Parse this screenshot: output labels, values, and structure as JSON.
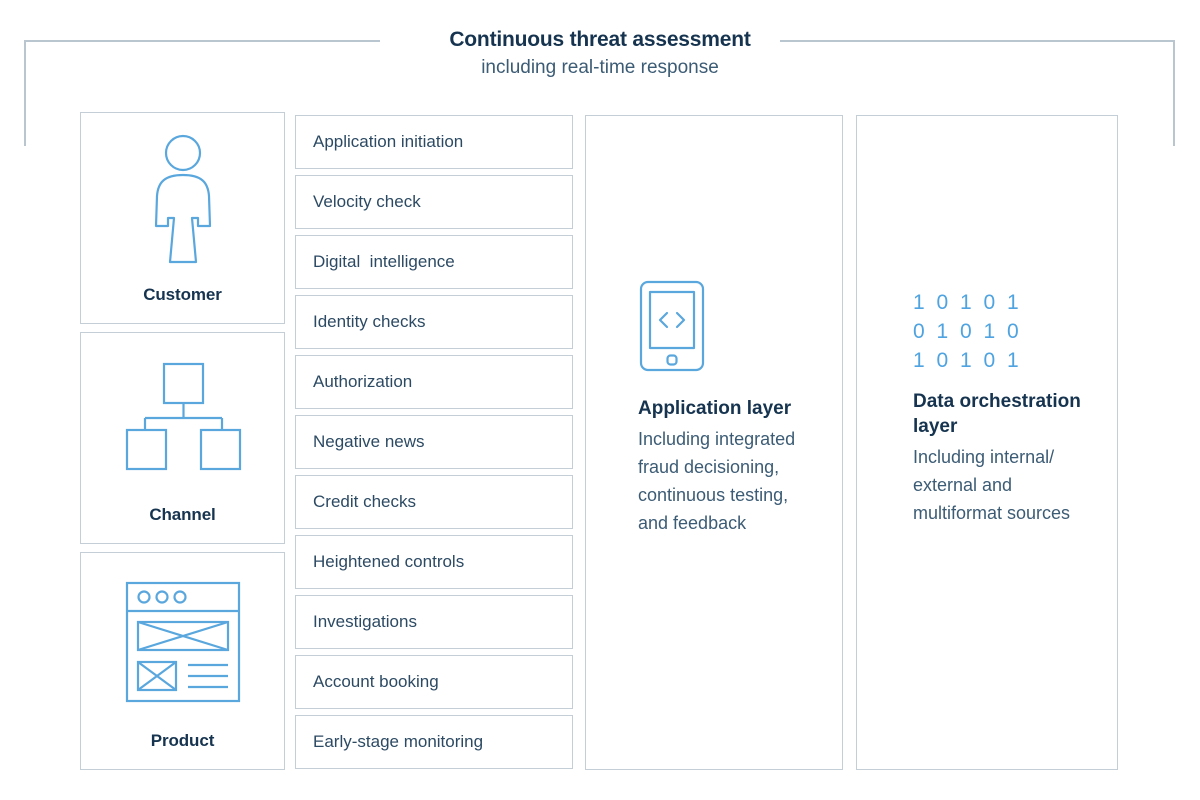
{
  "header": {
    "title": "Continuous threat assessment",
    "subtitle": "including real-time response"
  },
  "entities": [
    {
      "label": "Customer",
      "icon": "person-icon"
    },
    {
      "label": "Channel",
      "icon": "org-chart-icon"
    },
    {
      "label": "Product",
      "icon": "browser-wireframe-icon"
    }
  ],
  "checks": [
    {
      "label": "Application initiation"
    },
    {
      "label": "Velocity check"
    },
    {
      "label": "Digital  intelligence"
    },
    {
      "label": "Identity checks"
    },
    {
      "label": "Authorization"
    },
    {
      "label": "Negative news"
    },
    {
      "label": "Credit checks"
    },
    {
      "label": "Heightened controls"
    },
    {
      "label": "Investigations"
    },
    {
      "label": "Account booking"
    },
    {
      "label": "Early-stage monitoring"
    }
  ],
  "layers": [
    {
      "icon": "mobile-code-icon",
      "title": "Application layer",
      "description": "Including integrated fraud decisioning, continuous testing, and feedback"
    },
    {
      "icon": "binary-data-icon",
      "binary_rows": "1 0 1 0 1\n0 1 0 1 0\n1 0 1 0 1",
      "title": "Data orchestration layer",
      "description": "Including internal/ external and multiformat sources"
    }
  ],
  "colors": {
    "navy": "#16344f",
    "body_text": "#3c5c75",
    "border": "#c3ced7",
    "bracket": "#b9c6d0",
    "icon_blue": "#5aa7de",
    "binary_blue": "#4ea3e0"
  }
}
